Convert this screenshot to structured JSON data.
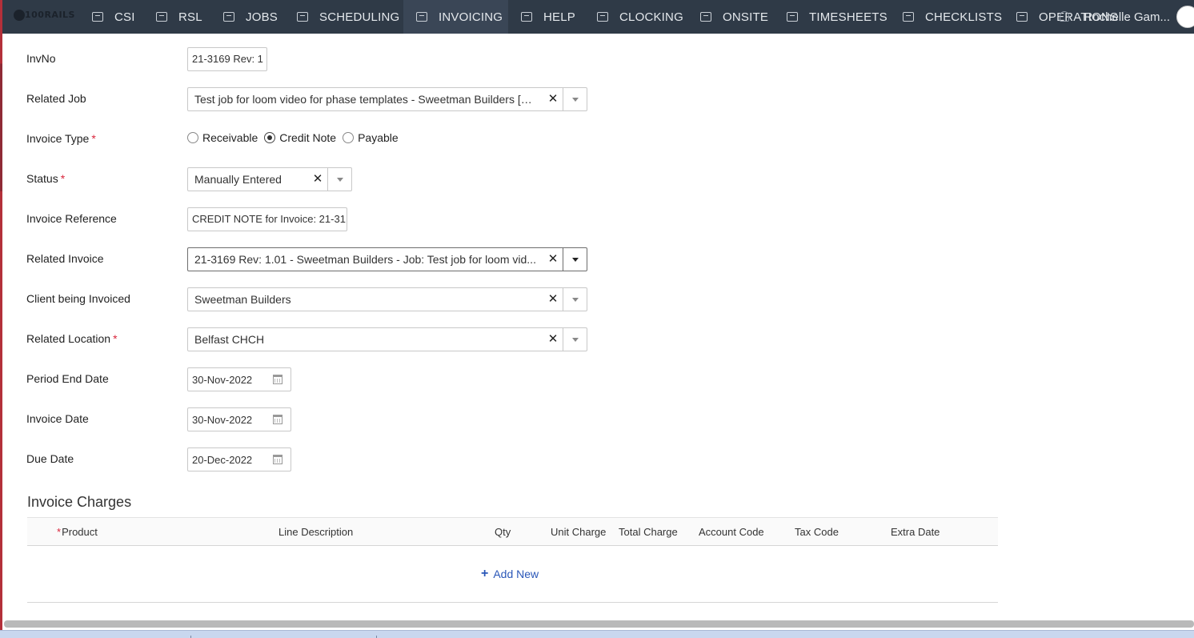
{
  "nav": {
    "logo": "100RAILS",
    "items": [
      {
        "label": "CSI"
      },
      {
        "label": "RSL"
      },
      {
        "label": "JOBS"
      },
      {
        "label": "SCHEDULING"
      },
      {
        "label": "INVOICING",
        "active": true
      },
      {
        "label": "HELP"
      },
      {
        "label": "CLOCKING"
      },
      {
        "label": "ONSITE"
      },
      {
        "label": "TIMESHEETS"
      },
      {
        "label": "CHECKLISTS"
      },
      {
        "label": "OPERATIONS"
      }
    ],
    "user_name": "Rochelle Gam..."
  },
  "form": {
    "invno": {
      "label": "InvNo",
      "value": "21-3169 Rev: 1"
    },
    "related_job": {
      "label": "Related Job",
      "value": "Test job for loom video for phase templates - Sweetman Builders [S..."
    },
    "invoice_type": {
      "label": "Invoice Type",
      "options": [
        "Receivable",
        "Credit Note",
        "Payable"
      ],
      "selected": "Credit Note"
    },
    "status": {
      "label": "Status",
      "value": "Manually Entered"
    },
    "invoice_reference": {
      "label": "Invoice Reference",
      "value": "CREDIT NOTE for Invoice: 21-31"
    },
    "related_invoice": {
      "label": "Related Invoice",
      "value": "21-3169 Rev: 1.01 - Sweetman Builders - Job: Test job for loom vid..."
    },
    "client": {
      "label": "Client being Invoiced",
      "value": "Sweetman Builders"
    },
    "related_location": {
      "label": "Related Location",
      "value": "Belfast CHCH"
    },
    "period_end_date": {
      "label": "Period End Date",
      "value": "30-Nov-2022"
    },
    "invoice_date": {
      "label": "Invoice Date",
      "value": "30-Nov-2022"
    },
    "due_date": {
      "label": "Due Date",
      "value": "20-Dec-2022"
    }
  },
  "charges": {
    "title": "Invoice Charges",
    "required_marker": "*",
    "columns": [
      "Product",
      "Line Description",
      "Qty",
      "Unit Charge",
      "Total Charge",
      "Account Code",
      "Tax Code",
      "Extra Date"
    ],
    "add_new": "Add New"
  }
}
